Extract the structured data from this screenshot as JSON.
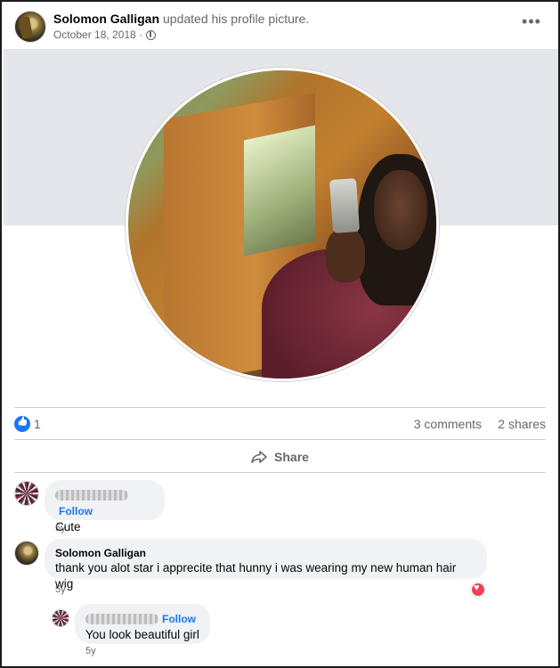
{
  "post": {
    "author": "Solomon Galligan",
    "action": "updated his profile picture.",
    "date": "October 18, 2018 ·",
    "privacy_icon": "globe-icon",
    "more_icon": "more-horizontal-icon",
    "more_label": "•••"
  },
  "stats": {
    "reaction_icon": "like-icon",
    "reactions": "1",
    "comments": "3 comments",
    "shares": "2 shares"
  },
  "actions": {
    "share_label": "Share",
    "share_icon": "share-arrow-icon"
  },
  "comments": [
    {
      "name": "",
      "follow": "Follow",
      "text": "Cute",
      "time": "5y"
    },
    {
      "name": "Solomon Galligan",
      "text": "thank you alot star i apprecite that hunny i was wearing my new human hair wig",
      "time": "5y",
      "reaction_icon": "love-icon"
    },
    {
      "name": "",
      "follow": "Follow",
      "text": "You look beautiful girl",
      "time": "5y"
    }
  ],
  "colors": {
    "link": "#1877f2",
    "love": "#f33e58",
    "bubble": "#f0f2f5",
    "secondary_text": "#65676b"
  }
}
